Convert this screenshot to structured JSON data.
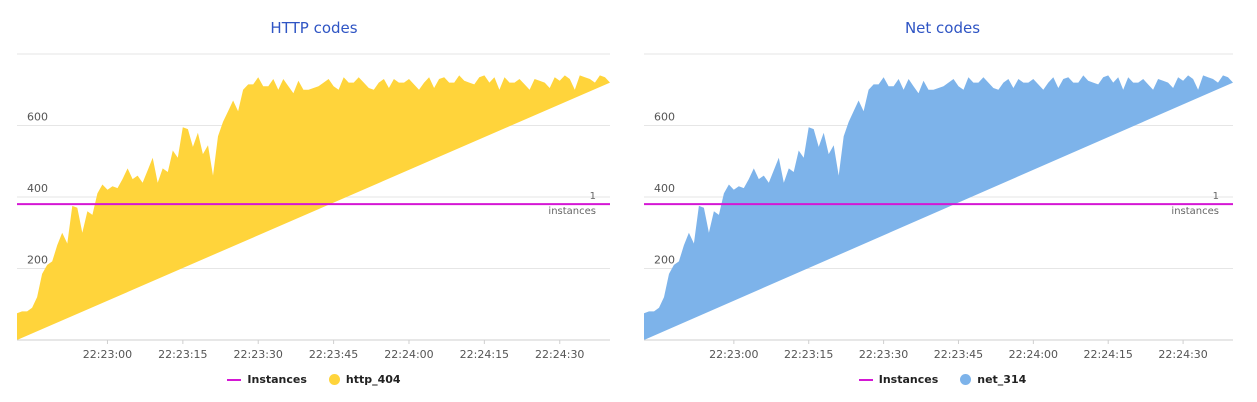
{
  "chart_data": [
    {
      "type": "area",
      "title": "HTTP codes",
      "x": [
        "22:22:42",
        "22:22:43",
        "22:22:44",
        "22:22:45",
        "22:22:46",
        "22:22:47",
        "22:22:48",
        "22:22:49",
        "22:22:50",
        "22:22:51",
        "22:22:52",
        "22:22:53",
        "22:22:54",
        "22:22:55",
        "22:22:56",
        "22:22:57",
        "22:22:58",
        "22:22:59",
        "22:23:00",
        "22:23:01",
        "22:23:02",
        "22:23:03",
        "22:23:04",
        "22:23:05",
        "22:23:06",
        "22:23:07",
        "22:23:08",
        "22:23:09",
        "22:23:10",
        "22:23:11",
        "22:23:12",
        "22:23:13",
        "22:23:14",
        "22:23:15",
        "22:23:16",
        "22:23:17",
        "22:23:18",
        "22:23:19",
        "22:23:20",
        "22:23:21",
        "22:23:22",
        "22:23:23",
        "22:23:24",
        "22:23:25",
        "22:23:26",
        "22:23:27",
        "22:23:28",
        "22:23:29",
        "22:23:30",
        "22:23:31",
        "22:23:32",
        "22:23:33",
        "22:23:34",
        "22:23:35",
        "22:23:36",
        "22:23:37",
        "22:23:38",
        "22:23:39",
        "22:23:40",
        "22:23:41",
        "22:23:42",
        "22:23:43",
        "22:23:44",
        "22:23:45",
        "22:23:46",
        "22:23:47",
        "22:23:48",
        "22:23:49",
        "22:23:50",
        "22:23:51",
        "22:23:52",
        "22:23:53",
        "22:23:54",
        "22:23:55",
        "22:23:56",
        "22:23:57",
        "22:23:58",
        "22:23:59",
        "22:24:00",
        "22:24:01",
        "22:24:02",
        "22:24:03",
        "22:24:04",
        "22:24:05",
        "22:24:06",
        "22:24:07",
        "22:24:08",
        "22:24:09",
        "22:24:10",
        "22:24:11",
        "22:24:12",
        "22:24:13",
        "22:24:14",
        "22:24:15",
        "22:24:16",
        "22:24:17",
        "22:24:18",
        "22:24:19",
        "22:24:20",
        "22:24:21",
        "22:24:22",
        "22:24:23",
        "22:24:24",
        "22:24:25",
        "22:24:26",
        "22:24:27",
        "22:24:28",
        "22:24:29",
        "22:24:30",
        "22:24:31",
        "22:24:32",
        "22:24:33",
        "22:24:34",
        "22:24:35",
        "22:24:36",
        "22:24:37",
        "22:24:38",
        "22:24:39",
        "22:24:40"
      ],
      "series": [
        {
          "name": "http_404",
          "values": [
            75,
            80,
            80,
            90,
            120,
            185,
            210,
            220,
            265,
            300,
            270,
            375,
            370,
            300,
            360,
            350,
            410,
            435,
            420,
            430,
            425,
            450,
            480,
            450,
            460,
            440,
            475,
            510,
            440,
            480,
            470,
            530,
            510,
            595,
            590,
            540,
            580,
            520,
            545,
            460,
            570,
            610,
            640,
            670,
            640,
            700,
            715,
            715,
            735,
            710,
            710,
            730,
            700,
            730,
            710,
            690,
            725,
            700,
            700,
            705,
            710,
            720,
            730,
            710,
            700,
            735,
            720,
            720,
            735,
            720,
            705,
            700,
            720,
            730,
            705,
            730,
            720,
            720,
            730,
            715,
            700,
            720,
            735,
            705,
            730,
            735,
            720,
            720,
            740,
            725,
            720,
            715,
            735,
            740,
            720,
            735,
            700,
            735,
            720,
            720,
            730,
            715,
            700,
            730,
            725,
            720,
            705,
            735,
            725,
            740,
            730,
            700,
            740,
            735,
            730,
            720,
            740,
            735,
            720,
            710,
            735
          ]
        }
      ],
      "threshold": {
        "name": "Instances",
        "value": 380,
        "label_value": "1",
        "label_unit": "instances"
      },
      "y_ticks": [
        200,
        400,
        600
      ],
      "x_ticks": [
        "22:23:00",
        "22:23:15",
        "22:23:30",
        "22:23:45",
        "22:24:00",
        "22:24:15",
        "22:24:30"
      ],
      "ylim": [
        0,
        800
      ],
      "grid": true,
      "legend_position": "bottom-center",
      "colors": {
        "area": "#ffd43b",
        "threshold": "#d417d4"
      }
    },
    {
      "type": "area",
      "title": "Net codes",
      "x": [
        "22:22:42",
        "22:22:43",
        "22:22:44",
        "22:22:45",
        "22:22:46",
        "22:22:47",
        "22:22:48",
        "22:22:49",
        "22:22:50",
        "22:22:51",
        "22:22:52",
        "22:22:53",
        "22:22:54",
        "22:22:55",
        "22:22:56",
        "22:22:57",
        "22:22:58",
        "22:22:59",
        "22:23:00",
        "22:23:01",
        "22:23:02",
        "22:23:03",
        "22:23:04",
        "22:23:05",
        "22:23:06",
        "22:23:07",
        "22:23:08",
        "22:23:09",
        "22:23:10",
        "22:23:11",
        "22:23:12",
        "22:23:13",
        "22:23:14",
        "22:23:15",
        "22:23:16",
        "22:23:17",
        "22:23:18",
        "22:23:19",
        "22:23:20",
        "22:23:21",
        "22:23:22",
        "22:23:23",
        "22:23:24",
        "22:23:25",
        "22:23:26",
        "22:23:27",
        "22:23:28",
        "22:23:29",
        "22:23:30",
        "22:23:31",
        "22:23:32",
        "22:23:33",
        "22:23:34",
        "22:23:35",
        "22:23:36",
        "22:23:37",
        "22:23:38",
        "22:23:39",
        "22:23:40",
        "22:23:41",
        "22:23:42",
        "22:23:43",
        "22:23:44",
        "22:23:45",
        "22:23:46",
        "22:23:47",
        "22:23:48",
        "22:23:49",
        "22:23:50",
        "22:23:51",
        "22:23:52",
        "22:23:53",
        "22:23:54",
        "22:23:55",
        "22:23:56",
        "22:23:57",
        "22:23:58",
        "22:23:59",
        "22:24:00",
        "22:24:01",
        "22:24:02",
        "22:24:03",
        "22:24:04",
        "22:24:05",
        "22:24:06",
        "22:24:07",
        "22:24:08",
        "22:24:09",
        "22:24:10",
        "22:24:11",
        "22:24:12",
        "22:24:13",
        "22:24:14",
        "22:24:15",
        "22:24:16",
        "22:24:17",
        "22:24:18",
        "22:24:19",
        "22:24:20",
        "22:24:21",
        "22:24:22",
        "22:24:23",
        "22:24:24",
        "22:24:25",
        "22:24:26",
        "22:24:27",
        "22:24:28",
        "22:24:29",
        "22:24:30",
        "22:24:31",
        "22:24:32",
        "22:24:33",
        "22:24:34",
        "22:24:35",
        "22:24:36",
        "22:24:37",
        "22:24:38",
        "22:24:39",
        "22:24:40"
      ],
      "series": [
        {
          "name": "net_314",
          "values": [
            75,
            80,
            80,
            90,
            120,
            185,
            210,
            220,
            265,
            300,
            270,
            375,
            370,
            300,
            360,
            350,
            410,
            435,
            420,
            430,
            425,
            450,
            480,
            450,
            460,
            440,
            475,
            510,
            440,
            480,
            470,
            530,
            510,
            595,
            590,
            540,
            580,
            520,
            545,
            460,
            570,
            610,
            640,
            670,
            640,
            700,
            715,
            715,
            735,
            710,
            710,
            730,
            700,
            730,
            710,
            690,
            725,
            700,
            700,
            705,
            710,
            720,
            730,
            710,
            700,
            735,
            720,
            720,
            735,
            720,
            705,
            700,
            720,
            730,
            705,
            730,
            720,
            720,
            730,
            715,
            700,
            720,
            735,
            705,
            730,
            735,
            720,
            720,
            740,
            725,
            720,
            715,
            735,
            740,
            720,
            735,
            700,
            735,
            720,
            720,
            730,
            715,
            700,
            730,
            725,
            720,
            705,
            735,
            725,
            740,
            730,
            700,
            740,
            735,
            730,
            720,
            740,
            735,
            720,
            710,
            735
          ]
        }
      ],
      "threshold": {
        "name": "Instances",
        "value": 380,
        "label_value": "1",
        "label_unit": "instances"
      },
      "y_ticks": [
        200,
        400,
        600
      ],
      "x_ticks": [
        "22:23:00",
        "22:23:15",
        "22:23:30",
        "22:23:45",
        "22:24:00",
        "22:24:15",
        "22:24:30"
      ],
      "ylim": [
        0,
        800
      ],
      "grid": true,
      "legend_position": "bottom-center",
      "colors": {
        "area": "#7db3ea",
        "threshold": "#d417d4"
      }
    }
  ]
}
